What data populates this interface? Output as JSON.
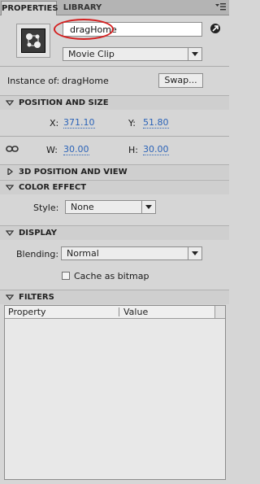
{
  "tabs": {
    "properties": "PROPERTIES",
    "library": "LIBRARY"
  },
  "panel_menu_icon": "panel-menu-icon",
  "symbol": {
    "icon": "movie-clip-symbol-icon"
  },
  "instance": {
    "name_value": "dragHome",
    "type_value": "Movie Clip",
    "instance_of_label": "Instance of:",
    "instance_of_value": "dragHome",
    "swap_label": "Swap..."
  },
  "position_size": {
    "header": "POSITION AND SIZE",
    "x_label": "X:",
    "x_value": "371.10",
    "y_label": "Y:",
    "y_value": "51.80",
    "w_label": "W:",
    "w_value": "30.00",
    "h_label": "H:",
    "h_value": "30.00"
  },
  "position_3d": {
    "header": "3D POSITION AND VIEW"
  },
  "color_effect": {
    "header": "COLOR EFFECT",
    "style_label": "Style:",
    "style_value": "None"
  },
  "display": {
    "header": "DISPLAY",
    "blending_label": "Blending:",
    "blending_value": "Normal",
    "cache_label": "Cache as bitmap",
    "cache_checked": false
  },
  "filters": {
    "header": "FILTERS",
    "columns": [
      "Property",
      "Value"
    ]
  },
  "colors": {
    "value_link": "#2b63b8",
    "highlight_ellipse": "#d42020"
  }
}
